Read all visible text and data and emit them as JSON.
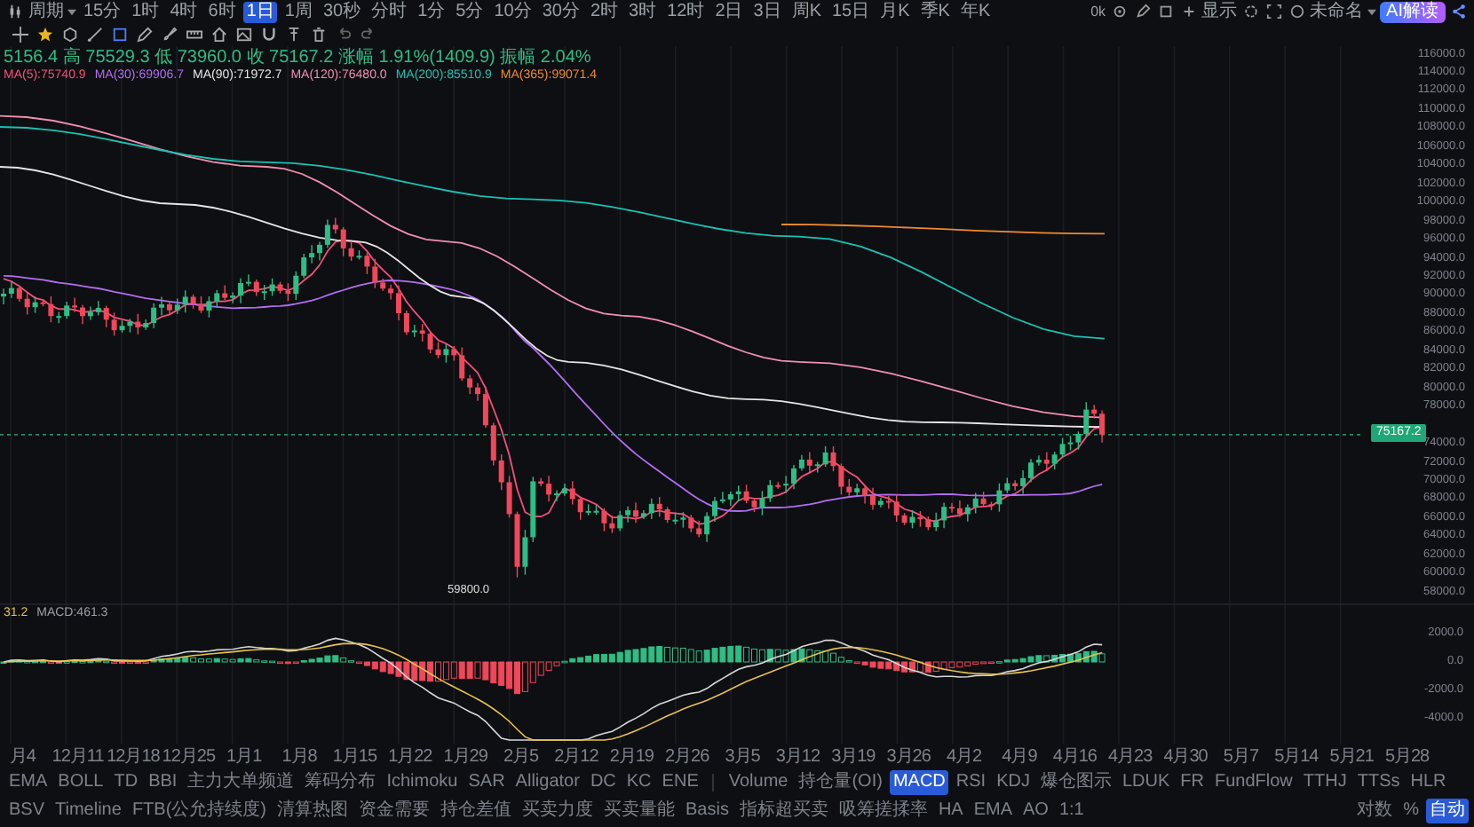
{
  "header": {
    "period_menu": "周期",
    "zoom_label": "0k",
    "display_label": "显示",
    "layout_name": "未命名",
    "ai_button": "AI解读"
  },
  "timeframes": [
    {
      "label": "15分",
      "selected": false
    },
    {
      "label": "1时",
      "selected": false
    },
    {
      "label": "4时",
      "selected": false
    },
    {
      "label": "6时",
      "selected": false
    },
    {
      "label": "1日",
      "selected": true
    },
    {
      "label": "1周",
      "selected": false
    },
    {
      "label": "30秒",
      "selected": false
    },
    {
      "label": "分时",
      "selected": false
    },
    {
      "label": "1分",
      "selected": false
    },
    {
      "label": "5分",
      "selected": false
    },
    {
      "label": "10分",
      "selected": false
    },
    {
      "label": "30分",
      "selected": false
    },
    {
      "label": "2时",
      "selected": false
    },
    {
      "label": "3时",
      "selected": false
    },
    {
      "label": "12时",
      "selected": false
    },
    {
      "label": "2日",
      "selected": false
    },
    {
      "label": "3日",
      "selected": false
    },
    {
      "label": "周K",
      "selected": false
    },
    {
      "label": "15日",
      "selected": false
    },
    {
      "label": "月K",
      "selected": false
    },
    {
      "label": "季K",
      "selected": false
    },
    {
      "label": "年K",
      "selected": false
    }
  ],
  "ohlc_legend": "5156.4 高 75529.3 低 73960.0 收 75167.2 涨幅 1.91%(1409.9) 振幅 2.04%",
  "ma_legend": [
    {
      "label": "MA(5):75740.9",
      "color": "#f4507c"
    },
    {
      "label": "MA(30):69906.7",
      "color": "#b36df2"
    },
    {
      "label": "MA(90):71972.7",
      "color": "#e6e6e6"
    },
    {
      "label": "MA(120):76480.0",
      "color": "#f28fb0"
    },
    {
      "label": "MA(200):85510.9",
      "color": "#19c2b5"
    },
    {
      "label": "MA(365):99071.4",
      "color": "#f08a2e"
    }
  ],
  "y_axis": [
    "116000.0",
    "114000.0",
    "112000.0",
    "110000.0",
    "108000.0",
    "106000.0",
    "104000.0",
    "102000.0",
    "100000.0",
    "98000.0",
    "96000.0",
    "94000.0",
    "92000.0",
    "90000.0",
    "88000.0",
    "86000.0",
    "84000.0",
    "82000.0",
    "80000.0",
    "78000.0",
    "74000.0",
    "72000.0",
    "70000.0",
    "68000.0",
    "66000.0",
    "64000.0",
    "62000.0",
    "60000.0",
    "58000.0"
  ],
  "last_price": "75167.2",
  "low_label": "59800.0",
  "macd_legend": [
    {
      "label": "31.2",
      "color": "#e8c34a"
    },
    {
      "label": "MACD:461.3",
      "color": "#9aa0a6"
    }
  ],
  "macd_axis": [
    "2000.0",
    "0.0",
    "-2000.0",
    "-4000.0"
  ],
  "dates": [
    "月4",
    "12月11",
    "12月18",
    "12月25",
    "1月1",
    "1月8",
    "1月15",
    "1月22",
    "1月29",
    "2月5",
    "2月12",
    "2月19",
    "2月26",
    "3月5",
    "3月12",
    "3月19",
    "3月26",
    "4月2",
    "4月9",
    "4月16",
    "4月23",
    "4月30",
    "5月7",
    "5月14",
    "5月21",
    "5月28"
  ],
  "overlay_indicators": [
    {
      "label": "EMA",
      "selected": false
    },
    {
      "label": "BOLL",
      "selected": false
    },
    {
      "label": "TD",
      "selected": false
    },
    {
      "label": "BBI",
      "selected": false
    },
    {
      "label": "主力大单频道",
      "selected": false
    },
    {
      "label": "筹码分布",
      "selected": false
    },
    {
      "label": "Ichimoku",
      "selected": false
    },
    {
      "label": "SAR",
      "selected": false
    },
    {
      "label": "Alligator",
      "selected": false
    },
    {
      "label": "DC",
      "selected": false
    },
    {
      "label": "KC",
      "selected": false
    },
    {
      "label": "ENE",
      "selected": false
    }
  ],
  "sub_indicators": [
    {
      "label": "Volume",
      "selected": false
    },
    {
      "label": "持仓量(OI)",
      "selected": false
    },
    {
      "label": "MACD",
      "selected": true
    },
    {
      "label": "RSI",
      "selected": false
    },
    {
      "label": "KDJ",
      "selected": false
    },
    {
      "label": "爆仓图示",
      "selected": false
    },
    {
      "label": "LDUK",
      "selected": false
    },
    {
      "label": "FR",
      "selected": false
    },
    {
      "label": "FundFlow",
      "selected": false
    },
    {
      "label": "TTHJ",
      "selected": false
    },
    {
      "label": "TTSs",
      "selected": false
    },
    {
      "label": "HLR",
      "selected": false
    },
    {
      "label": "BSV",
      "selected": false
    },
    {
      "label": "Timeline",
      "selected": false
    },
    {
      "label": "FTB(公允持续度)",
      "selected": false
    },
    {
      "label": "清算热图",
      "selected": false
    },
    {
      "label": "资金需要",
      "selected": false
    },
    {
      "label": "持仓差值",
      "selected": false
    },
    {
      "label": "买卖力度",
      "selected": false
    },
    {
      "label": "买卖量能",
      "selected": false
    },
    {
      "label": "Basis",
      "selected": false
    },
    {
      "label": "指标超买卖",
      "selected": false
    },
    {
      "label": "吸筹搓揉率",
      "selected": false
    },
    {
      "label": "HA",
      "selected": false
    },
    {
      "label": "EMA",
      "selected": false
    },
    {
      "label": "AO",
      "selected": false
    },
    {
      "label": "1:1",
      "selected": false
    }
  ],
  "scale_options": [
    {
      "label": "对数",
      "selected": false
    },
    {
      "label": "%",
      "selected": false
    },
    {
      "label": "自动",
      "selected": true
    }
  ]
}
